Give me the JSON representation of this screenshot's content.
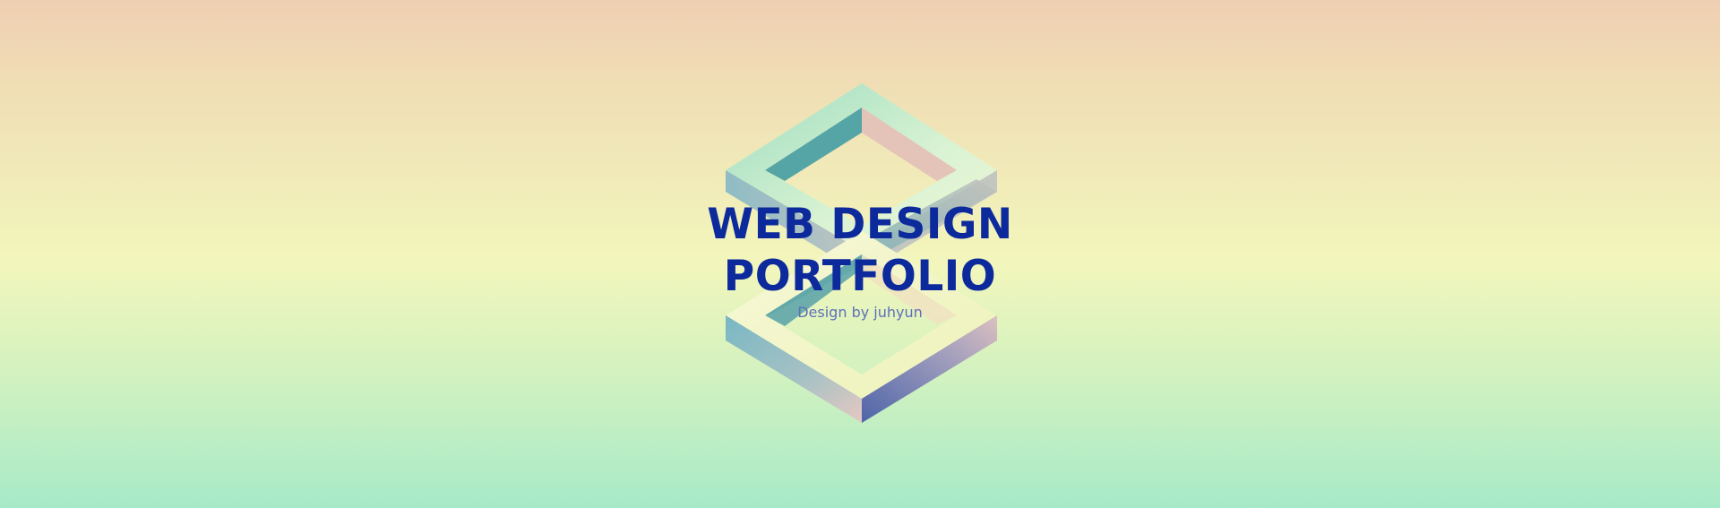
{
  "banner": {
    "title_line_1": "WEB DESIGN",
    "title_line_2": "PORTFOLIO",
    "subtitle": "Design by juhyun"
  },
  "logo": {
    "icon": "isometric-s-emblem-icon"
  },
  "colors": {
    "title": "#0d2a9c",
    "subtitle": "#5e6fb8",
    "background_top": "#efcfb2",
    "background_middle": "#f2f6bc",
    "background_bottom": "#a7eac8"
  }
}
